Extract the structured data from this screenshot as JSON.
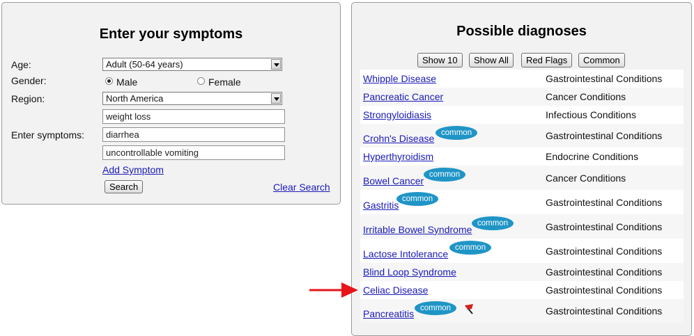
{
  "symptom_form": {
    "title": "Enter your symptoms",
    "age_label": "Age:",
    "age_value": "Adult (50-64 years)",
    "gender_label": "Gender:",
    "gender_male": "Male",
    "gender_female": "Female",
    "region_label": "Region:",
    "region_value": "North America",
    "symptoms_label": "Enter symptoms:",
    "symptoms": [
      "weight loss",
      "diarrhea",
      "uncontrollable vomiting"
    ],
    "add_symptom": "Add Symptom",
    "search": "Search",
    "clear_search": "Clear Search"
  },
  "diagnoses": {
    "title": "Possible diagnoses",
    "buttons": [
      "Show 10",
      "Show All",
      "Red Flags",
      "Common"
    ],
    "common_badge": "common",
    "items": [
      {
        "name": "Whipple Disease",
        "category": "Gastrointestinal Conditions",
        "common": false,
        "red_flag": false
      },
      {
        "name": "Pancreatic Cancer",
        "category": "Cancer Conditions",
        "common": false,
        "red_flag": false
      },
      {
        "name": "Strongyloidiasis",
        "category": "Infectious Conditions",
        "common": false,
        "red_flag": false
      },
      {
        "name": "Crohn's Disease",
        "category": "Gastrointestinal Conditions",
        "common": true,
        "red_flag": false
      },
      {
        "name": "Hyperthyroidism",
        "category": "Endocrine Conditions",
        "common": false,
        "red_flag": false
      },
      {
        "name": "Bowel Cancer",
        "category": "Cancer Conditions",
        "common": true,
        "red_flag": false
      },
      {
        "name": "Gastritis",
        "category": "Gastrointestinal Conditions",
        "common": true,
        "red_flag": false
      },
      {
        "name": "Irritable Bowel Syndrome",
        "category": "Gastrointestinal Conditions",
        "common": true,
        "red_flag": false
      },
      {
        "name": "Lactose Intolerance",
        "category": "Gastrointestinal Conditions",
        "common": true,
        "red_flag": false
      },
      {
        "name": "Blind Loop Syndrome",
        "category": "Gastrointestinal Conditions",
        "common": false,
        "red_flag": false
      },
      {
        "name": "Celiac Disease",
        "category": "Gastrointestinal Conditions",
        "common": false,
        "red_flag": false
      },
      {
        "name": "Pancreatitis",
        "category": "Gastrointestinal Conditions",
        "common": true,
        "red_flag": true
      }
    ]
  },
  "colors": {
    "badge": "#1f95c6",
    "link": "#1a1ab8",
    "arrow": "#e8141b",
    "flag": "#d81e1e"
  }
}
